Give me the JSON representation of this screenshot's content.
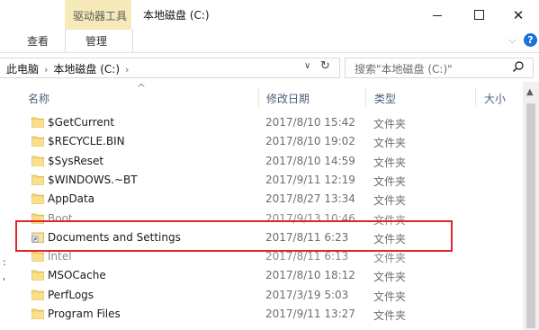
{
  "titlebar": {
    "context_tab": "驱动器工具",
    "title": "本地磁盘 (C:)",
    "close_glyph": "✕"
  },
  "ribbon": {
    "tab_view": "查看",
    "tab_manage": "管理",
    "expand_glyph": "⌵",
    "help_glyph": "?"
  },
  "address": {
    "crumb1": "此电脑",
    "crumb2": "本地磁盘 (C:)",
    "separator": "›",
    "dropdown_glyph": "∨",
    "refresh_glyph": "↻",
    "search_placeholder": "搜索\"本地磁盘 (C:)\""
  },
  "columns": {
    "name": "名称",
    "date": "修改日期",
    "type": "类型",
    "size": "大小",
    "sort_glyph": "^"
  },
  "files": [
    {
      "name": "$GetCurrent",
      "date": "2017/8/10 15:42",
      "type": "文件夹",
      "icon": "folder-icon",
      "state": "normal"
    },
    {
      "name": "$RECYCLE.BIN",
      "date": "2017/8/10 19:02",
      "type": "文件夹",
      "icon": "folder-icon",
      "state": "normal"
    },
    {
      "name": "$SysReset",
      "date": "2017/8/10 14:59",
      "type": "文件夹",
      "icon": "folder-icon",
      "state": "normal"
    },
    {
      "name": "$WINDOWS.~BT",
      "date": "2017/9/11 12:19",
      "type": "文件夹",
      "icon": "folder-icon",
      "state": "normal"
    },
    {
      "name": "AppData",
      "date": "2017/8/27 13:34",
      "type": "文件夹",
      "icon": "folder-icon",
      "state": "normal"
    },
    {
      "name": "Boot",
      "date": "2017/9/13 10:46",
      "type": "文件夹",
      "icon": "folder-icon",
      "state": "obscured"
    },
    {
      "name": "Documents and Settings",
      "date": "2017/8/11 6:23",
      "type": "文件夹",
      "icon": "shortcut-folder-icon",
      "state": "highlighted"
    },
    {
      "name": "Intel",
      "date": "2017/8/11 6:13",
      "type": "文件夹",
      "icon": "folder-icon",
      "state": "obscured"
    },
    {
      "name": "MSOCache",
      "date": "2017/8/10 18:12",
      "type": "文件夹",
      "icon": "folder-icon",
      "state": "normal"
    },
    {
      "name": "PerfLogs",
      "date": "2017/3/19 5:03",
      "type": "文件夹",
      "icon": "folder-icon",
      "state": "normal"
    },
    {
      "name": "Program Files",
      "date": "2017/9/11 13:27",
      "type": "文件夹",
      "icon": "folder-icon",
      "state": "normal"
    }
  ],
  "colors": {
    "context_tab_bg": "#f6eab8",
    "highlight_border": "#e0262b",
    "folder_fill": "#f8d775",
    "header_text": "#4c607a"
  }
}
